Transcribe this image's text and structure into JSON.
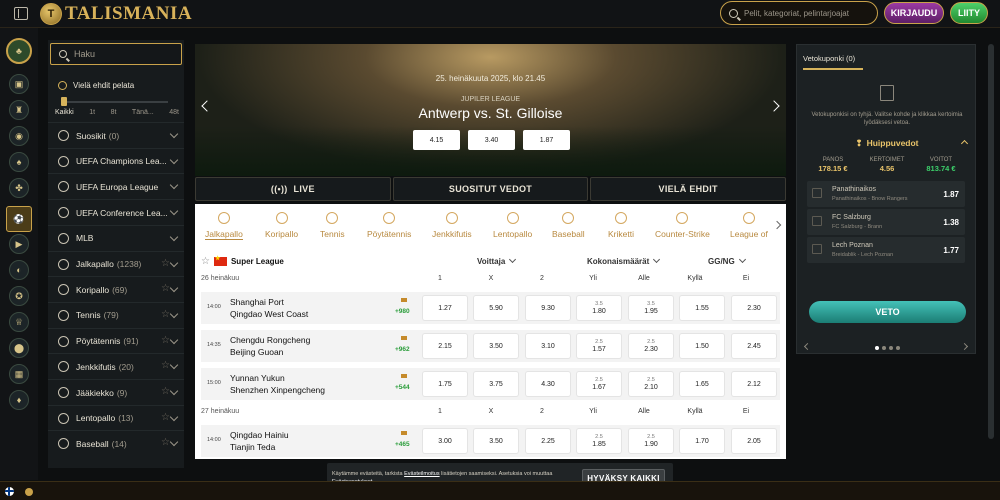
{
  "header": {
    "logo": "TALISMANIA",
    "search_placeholder": "Pelit, kategoriat, pelintarjoajat",
    "login_label": "KIRJAUDU",
    "join_label": "LIITY"
  },
  "sidebar": {
    "search_placeholder": "Haku",
    "time_filter_label": "Vielä ehdit pelata",
    "time_options": [
      "Kaikki",
      "1t",
      "8t",
      "Tänä...",
      "48t"
    ],
    "items": [
      {
        "label": "Suosikit",
        "count": "(0)",
        "icon": "star-icon"
      },
      {
        "label": "UEFA Champions Lea...",
        "count": "",
        "icon": "football-icon"
      },
      {
        "label": "UEFA Europa League",
        "count": "",
        "icon": "football-icon"
      },
      {
        "label": "UEFA Conference Lea...",
        "count": "",
        "icon": "football-icon"
      },
      {
        "label": "MLB",
        "count": "",
        "icon": "baseball-icon"
      },
      {
        "label": "Jalkapallo",
        "count": "(1238)",
        "icon": "football-icon"
      },
      {
        "label": "Koripallo",
        "count": "(69)",
        "icon": "basketball-icon"
      },
      {
        "label": "Tennis",
        "count": "(79)",
        "icon": "tennis-icon"
      },
      {
        "label": "Pöytätennis",
        "count": "(91)",
        "icon": "table-tennis-icon"
      },
      {
        "label": "Jenkkifutis",
        "count": "(20)",
        "icon": "american-football-icon"
      },
      {
        "label": "Jääkiekko",
        "count": "(9)",
        "icon": "ice-hockey-icon"
      },
      {
        "label": "Lentopallo",
        "count": "(13)",
        "icon": "volleyball-icon"
      },
      {
        "label": "Baseball",
        "count": "(14)",
        "icon": "baseball-icon"
      }
    ]
  },
  "hero": {
    "date": "25. heinäkuuta 2025, klo 21.45",
    "league": "JUPILER LEAGUE",
    "match": "Antwerp vs. St. Gilloise",
    "odds": [
      "4.15",
      "3.40",
      "1.87"
    ]
  },
  "tabs": [
    "LIVE",
    "SUOSITUT VEDOT",
    "VIELÄ EHDIT"
  ],
  "sports_strip": [
    "Jalkapallo",
    "Koripallo",
    "Tennis",
    "Pöytätennis",
    "Jenkkifutis",
    "Lentopallo",
    "Baseball",
    "Kriketti",
    "Counter-Strike",
    "League of"
  ],
  "league": {
    "name": "Super League"
  },
  "markets": [
    "Voittaja",
    "Kokonaismäärät",
    "GG/NG"
  ],
  "columns": [
    "1",
    "X",
    "2",
    "Yli",
    "Alle",
    "Kyllä",
    "Ei"
  ],
  "days": [
    "26 heinäkuu",
    "27 heinäkuu"
  ],
  "matches": [
    {
      "time": "14:00",
      "home": "Shanghai Port",
      "away": "Qingdao West Coast",
      "more": "+980",
      "o1": "1.27",
      "ox": "5.90",
      "o2": "9.30",
      "yli_line": "3.5",
      "yli": "1.80",
      "alle_line": "3.5",
      "alle": "1.95",
      "kylla": "1.55",
      "ei": "2.30"
    },
    {
      "time": "14:35",
      "home": "Chengdu Rongcheng",
      "away": "Beijing Guoan",
      "more": "+962",
      "o1": "2.15",
      "ox": "3.50",
      "o2": "3.10",
      "yli_line": "2.5",
      "yli": "1.57",
      "alle_line": "2.5",
      "alle": "2.30",
      "kylla": "1.50",
      "ei": "2.45"
    },
    {
      "time": "15:00",
      "home": "Yunnan Yukun",
      "away": "Shenzhen Xinpengcheng",
      "more": "+544",
      "o1": "1.75",
      "ox": "3.75",
      "o2": "4.30",
      "yli_line": "2.5",
      "yli": "1.67",
      "alle_line": "2.5",
      "alle": "2.10",
      "kylla": "1.65",
      "ei": "2.12"
    },
    {
      "time": "14:00",
      "home": "Qingdao Hainiu",
      "away": "Tianjin Teda",
      "more": "+465",
      "o1": "3.00",
      "ox": "3.50",
      "o2": "2.25",
      "yli_line": "2.5",
      "yli": "1.85",
      "alle_line": "2.5",
      "alle": "1.90",
      "kylla": "1.70",
      "ei": "2.05"
    }
  ],
  "betslip": {
    "title": "Vetokuponki (0)",
    "empty_text": "Vetokuponkisi on tyhjä. Valitse kohde ja klikkaa kertoimia lyödäksesi vetoa.",
    "hot_title": "Huippuvedot",
    "stats": [
      {
        "label": "PANOS",
        "value": "178.15 €"
      },
      {
        "label": "KERTOIMET",
        "value": "4.56"
      },
      {
        "label": "VOITOT",
        "value": "813.74 €"
      }
    ],
    "hot_bets": [
      {
        "team": "Panathinaikos",
        "match": "Panathinaikos - Bnow Rangers",
        "odd": "1.87"
      },
      {
        "team": "FC Salzburg",
        "match": "FC Salzburg - Brann",
        "odd": "1.38"
      },
      {
        "team": "Lech Poznan",
        "match": "Breidablik - Lech Poznan",
        "odd": "1.77"
      }
    ],
    "veto_label": "VETO"
  },
  "cookie": {
    "text_a": "Käytämme evästeitä, tarkista ",
    "policy_link": "Evästeilmoitus",
    "text_b": " lisätietojen saamiseksi. Asetuksia voi muuttaa ",
    "settings_link": "Evästeasetukset",
    "accept_label": "HYVÄKSY KAIKKI"
  }
}
